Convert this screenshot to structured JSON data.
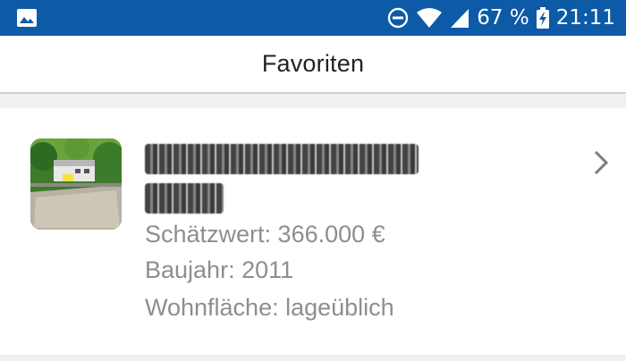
{
  "status_bar": {
    "battery": "67 %",
    "time": "21:11",
    "icons": [
      "gallery-icon",
      "do-not-disturb-icon",
      "wifi-icon",
      "cell-signal-icon",
      "battery-charging-icon"
    ]
  },
  "header": {
    "title": "Favoriten"
  },
  "favorites": [
    {
      "name_redacted": true,
      "estimated_value": "Schätzwert: 366.000 €",
      "build_year": "Baujahr: 2011",
      "living_area": "Wohnfläche: lageüblich",
      "icon": "chevron-right-icon"
    }
  ],
  "colors": {
    "status_bar": "#0d5aa7",
    "detail_text": "#8e8e8e",
    "background": "#f0f0f0"
  }
}
